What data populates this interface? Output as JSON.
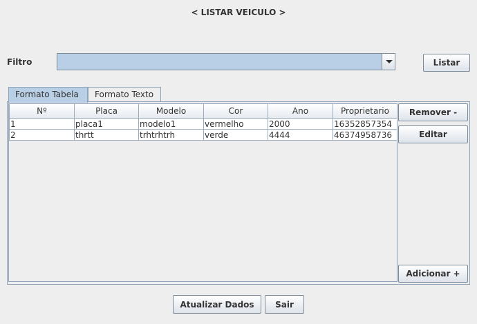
{
  "window": {
    "title": "< LISTAR VEICULO >"
  },
  "filter": {
    "label": "Filtro",
    "value": "",
    "list_button": "Listar"
  },
  "tabs": [
    {
      "label": "Formato Tabela",
      "active": true
    },
    {
      "label": "Formato Texto",
      "active": false
    }
  ],
  "table": {
    "columns": [
      "Nº",
      "Placa",
      "Modelo",
      "Cor",
      "Ano",
      "Proprietario"
    ],
    "rows": [
      [
        "1",
        "placa1",
        "modelo1",
        "vermelho",
        "2000",
        "16352857354"
      ],
      [
        "2",
        "thrtt",
        "trhtrhtrh",
        "verde",
        "4444",
        "46374958736"
      ]
    ]
  },
  "side_buttons": {
    "remove": "Remover -",
    "edit": "Editar",
    "add": "Adicionar +"
  },
  "footer": {
    "refresh": "Atualizar Dados",
    "exit": "Sair"
  },
  "colors": {
    "accent": "#b8cfe5",
    "border": "#8da2b7",
    "background": "#eeeeee"
  }
}
